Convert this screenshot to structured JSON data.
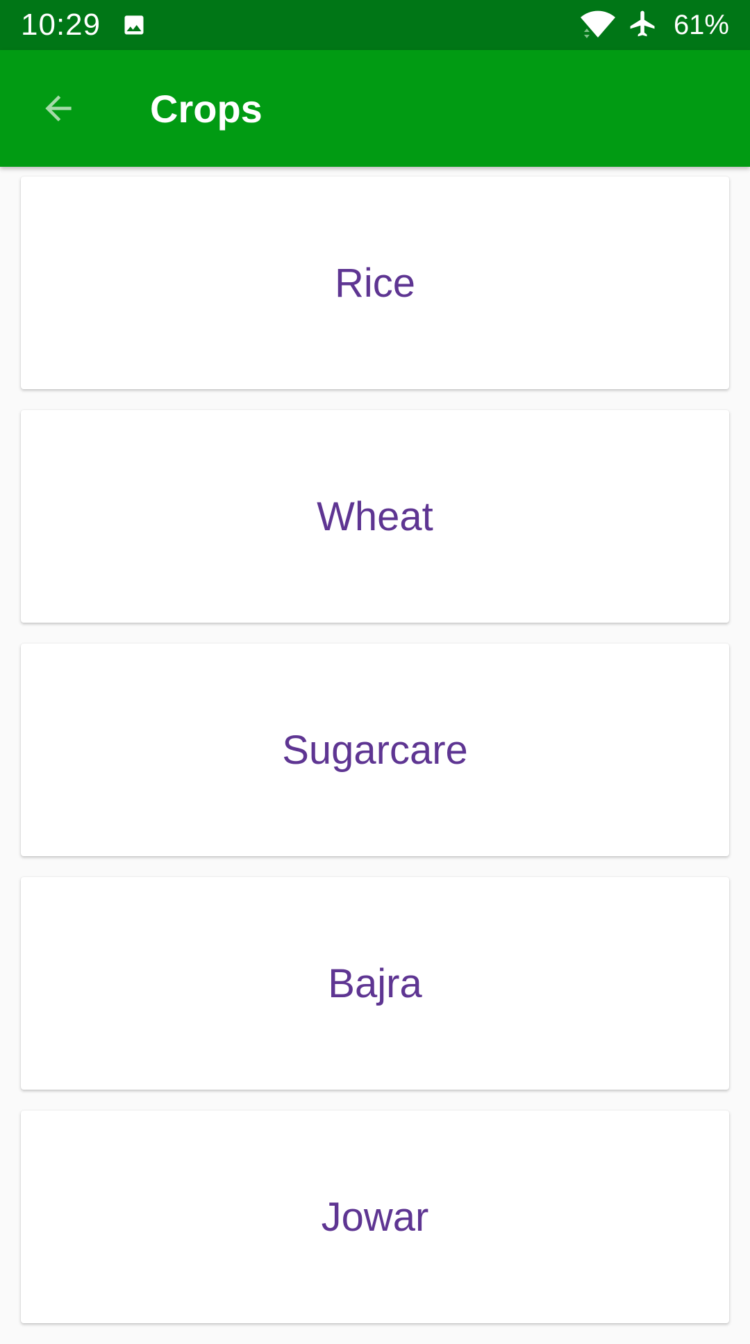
{
  "status_bar": {
    "time": "10:29",
    "battery": "61%",
    "icons": [
      "image-icon",
      "wifi-icon",
      "airplane-icon"
    ]
  },
  "app_bar": {
    "title": "Crops",
    "back_icon": "arrow-back-icon"
  },
  "crops": [
    {
      "label": "Rice"
    },
    {
      "label": "Wheat"
    },
    {
      "label": "Sugarcare"
    },
    {
      "label": "Bajra"
    },
    {
      "label": "Jowar"
    }
  ],
  "colors": {
    "status_bar": "#007616",
    "app_bar": "#019b13",
    "label": "#5e3592",
    "background": "#fafafa"
  }
}
